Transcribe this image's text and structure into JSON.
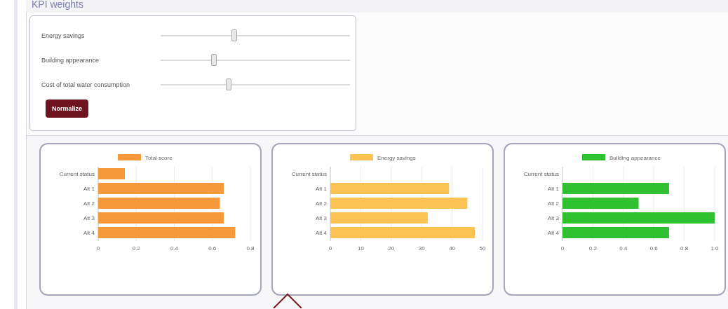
{
  "panel": {
    "title": "KPI weights"
  },
  "sliders": [
    {
      "label": "Energy savings",
      "level": 0.39
    },
    {
      "label": "Building appearance",
      "level": 0.28
    },
    {
      "label": "Cost of total water consumption",
      "level": 0.36
    }
  ],
  "normalize_button": "Normalize",
  "charts": [
    {
      "chart_data": {
        "type": "bar",
        "orientation": "horizontal",
        "categories": [
          "Current status",
          "Alt 1",
          "Alt 2",
          "Alt 3",
          "Alt 4"
        ],
        "series": [
          {
            "name": "Total score",
            "color": "#f7983a",
            "values": [
              0.14,
              0.66,
              0.64,
              0.66,
              0.72
            ]
          }
        ],
        "grid": true,
        "xlim": [
          0,
          0.8
        ],
        "xticks": [
          0,
          0.2,
          0.4,
          {
            "value": 0.6,
            "label": "0.6"
          },
          {
            "value": 0.8,
            "label": "0.8"
          }
        ]
      }
    },
    {
      "chart_data": {
        "type": "bar",
        "orientation": "horizontal",
        "categories": [
          "Current status",
          "Alt 1",
          "Alt 2",
          "Alt 3",
          "Alt 4"
        ],
        "series": [
          {
            "name": "Energy savings",
            "color": "#fcc254",
            "values": [
              0,
              39,
              45,
              32,
              47.5
            ]
          }
        ],
        "grid": true,
        "xlim": [
          0,
          50
        ],
        "xticks": [
          0,
          10,
          20,
          30,
          40,
          50
        ]
      }
    },
    {
      "chart_data": {
        "type": "bar",
        "orientation": "horizontal",
        "categories": [
          "Current status",
          "Alt 1",
          "Alt 2",
          "Alt 3",
          "Alt 4"
        ],
        "series": [
          {
            "name": "Building appearance",
            "color": "#2fc12f",
            "values": [
              0,
              0.7,
              0.5,
              1.0,
              0.7
            ]
          }
        ],
        "grid": true,
        "xlim": [
          0,
          1
        ],
        "xticks": [
          0,
          0.2,
          0.4,
          0.6,
          0.8,
          {
            "value": 1,
            "label": "1.0"
          }
        ]
      }
    }
  ]
}
